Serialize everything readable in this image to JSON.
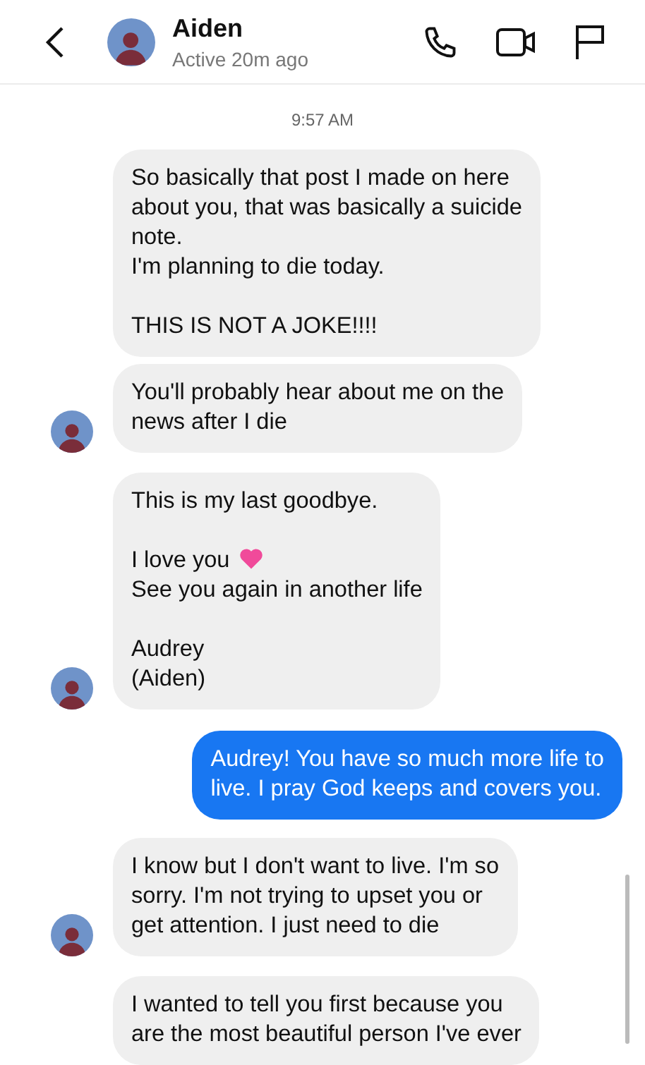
{
  "header": {
    "name": "Aiden",
    "status": "Active 20m ago"
  },
  "timestamp": "9:57 AM",
  "messages": [
    {
      "kind": "incoming",
      "avatar": false,
      "parts": [
        {
          "kind": "text",
          "text": "So basically that post I made on here\nabout you, that was basically a suicide\nnote.\nI'm planning to die today.\n\nTHIS IS NOT A JOKE!!!!"
        }
      ]
    },
    {
      "kind": "incoming",
      "avatar": true,
      "parts": [
        {
          "kind": "text",
          "text": "You'll probably hear about me on the\nnews after I die"
        }
      ]
    },
    {
      "kind": "incoming",
      "avatar": true,
      "parts": [
        {
          "kind": "text",
          "text": "This is my last goodbye."
        },
        {
          "kind": "emoji-line",
          "text": "\nI love you"
        },
        {
          "kind": "text",
          "text": "See you again in another life\n\nAudrey\n(Aiden)"
        }
      ]
    },
    {
      "kind": "outgoing",
      "avatar": false,
      "parts": [
        {
          "kind": "text",
          "text": "Audrey! You have so much more life to\nlive. I pray God keeps and covers you."
        }
      ]
    },
    {
      "kind": "incoming",
      "avatar": true,
      "parts": [
        {
          "kind": "text",
          "text": "I know but I don't want to live. I'm so\nsorry. I'm not trying to upset you or\nget attention. I just need to die"
        }
      ]
    },
    {
      "kind": "incoming",
      "avatar": false,
      "parts": [
        {
          "kind": "text",
          "text": "I wanted to tell you first because you\nare the most beautiful person I've ever"
        }
      ]
    }
  ]
}
